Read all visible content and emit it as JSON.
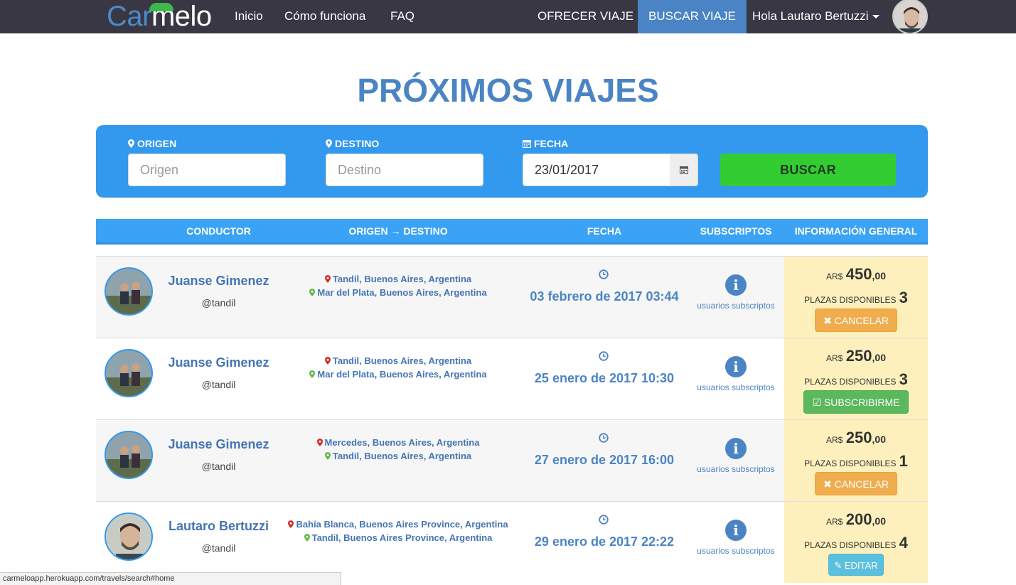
{
  "nav": {
    "brand_part1": "Car",
    "brand_part2": "melo",
    "links": [
      "Inicio",
      "Cómo funciona",
      "FAQ"
    ],
    "offer": "OFRECER VIAJE",
    "search": "BUSCAR VIAJE",
    "greeting": "Hola Lautaro Bertuzzi"
  },
  "title": "PRÓXIMOS VIAJES",
  "search_form": {
    "origin_label": "ORIGEN",
    "origin_placeholder": "Origen",
    "dest_label": "DESTINO",
    "dest_placeholder": "Destino",
    "date_label": "FECHA",
    "date_value": "23/01/2017",
    "button": "BUSCAR"
  },
  "table": {
    "headers": [
      "CONDUCTOR",
      "ORIGEN → DESTINO",
      "FECHA",
      "SUBSCRIPTOS",
      "INFORMACIÓN GENERAL"
    ],
    "rows": [
      {
        "name": "Juanse Gimenez",
        "handle": "@tandil",
        "origin": "Tandil, Buenos Aires, Argentina",
        "destination": "Mar del Plata, Buenos Aires, Argentina",
        "date": "03 febrero de 2017 03:44",
        "subs": "usuarios subscriptos",
        "currency": "AR$",
        "price": "450",
        "cents": ",00",
        "seats_label": "PLAZAS DISPONIBLES",
        "seats": "3",
        "action": "CANCELAR"
      },
      {
        "name": "Juanse Gimenez",
        "handle": "@tandil",
        "origin": "Tandil, Buenos Aires, Argentina",
        "destination": "Mar del Plata, Buenos Aires, Argentina",
        "date": "25 enero de 2017 10:30",
        "subs": "usuarios subscriptos",
        "currency": "AR$",
        "price": "250",
        "cents": ",00",
        "seats_label": "PLAZAS DISPONIBLES",
        "seats": "3",
        "action": "SUBSCRIBIRME"
      },
      {
        "name": "Juanse Gimenez",
        "handle": "@tandil",
        "origin": "Mercedes, Buenos Aires, Argentina",
        "destination": "Tandil, Buenos Aires, Argentina",
        "date": "27 enero de 2017 16:00",
        "subs": "usuarios subscriptos",
        "currency": "AR$",
        "price": "250",
        "cents": ",00",
        "seats_label": "PLAZAS DISPONIBLES",
        "seats": "1",
        "action": "CANCELAR"
      },
      {
        "name": "Lautaro Bertuzzi",
        "handle": "@tandil",
        "origin": "Bahía Blanca, Buenos Aires Province, Argentina",
        "destination": "Tandil, Buenos Aires Province, Argentina",
        "date": "29 enero de 2017 22:22",
        "subs": "usuarios subscriptos",
        "currency": "AR$",
        "price": "200",
        "cents": ",00",
        "seats_label": "PLAZAS DISPONIBLES",
        "seats": "4",
        "action": "EDITAR"
      }
    ]
  },
  "status_url": "carmeloapp.herokuapp.com/travels/search#home",
  "colors": {
    "nav_bg": "#383743",
    "accent": "#4b84c4",
    "panel": "#3399ee",
    "search_btn": "#33cc33",
    "info_bg": "#fdf0bd"
  }
}
